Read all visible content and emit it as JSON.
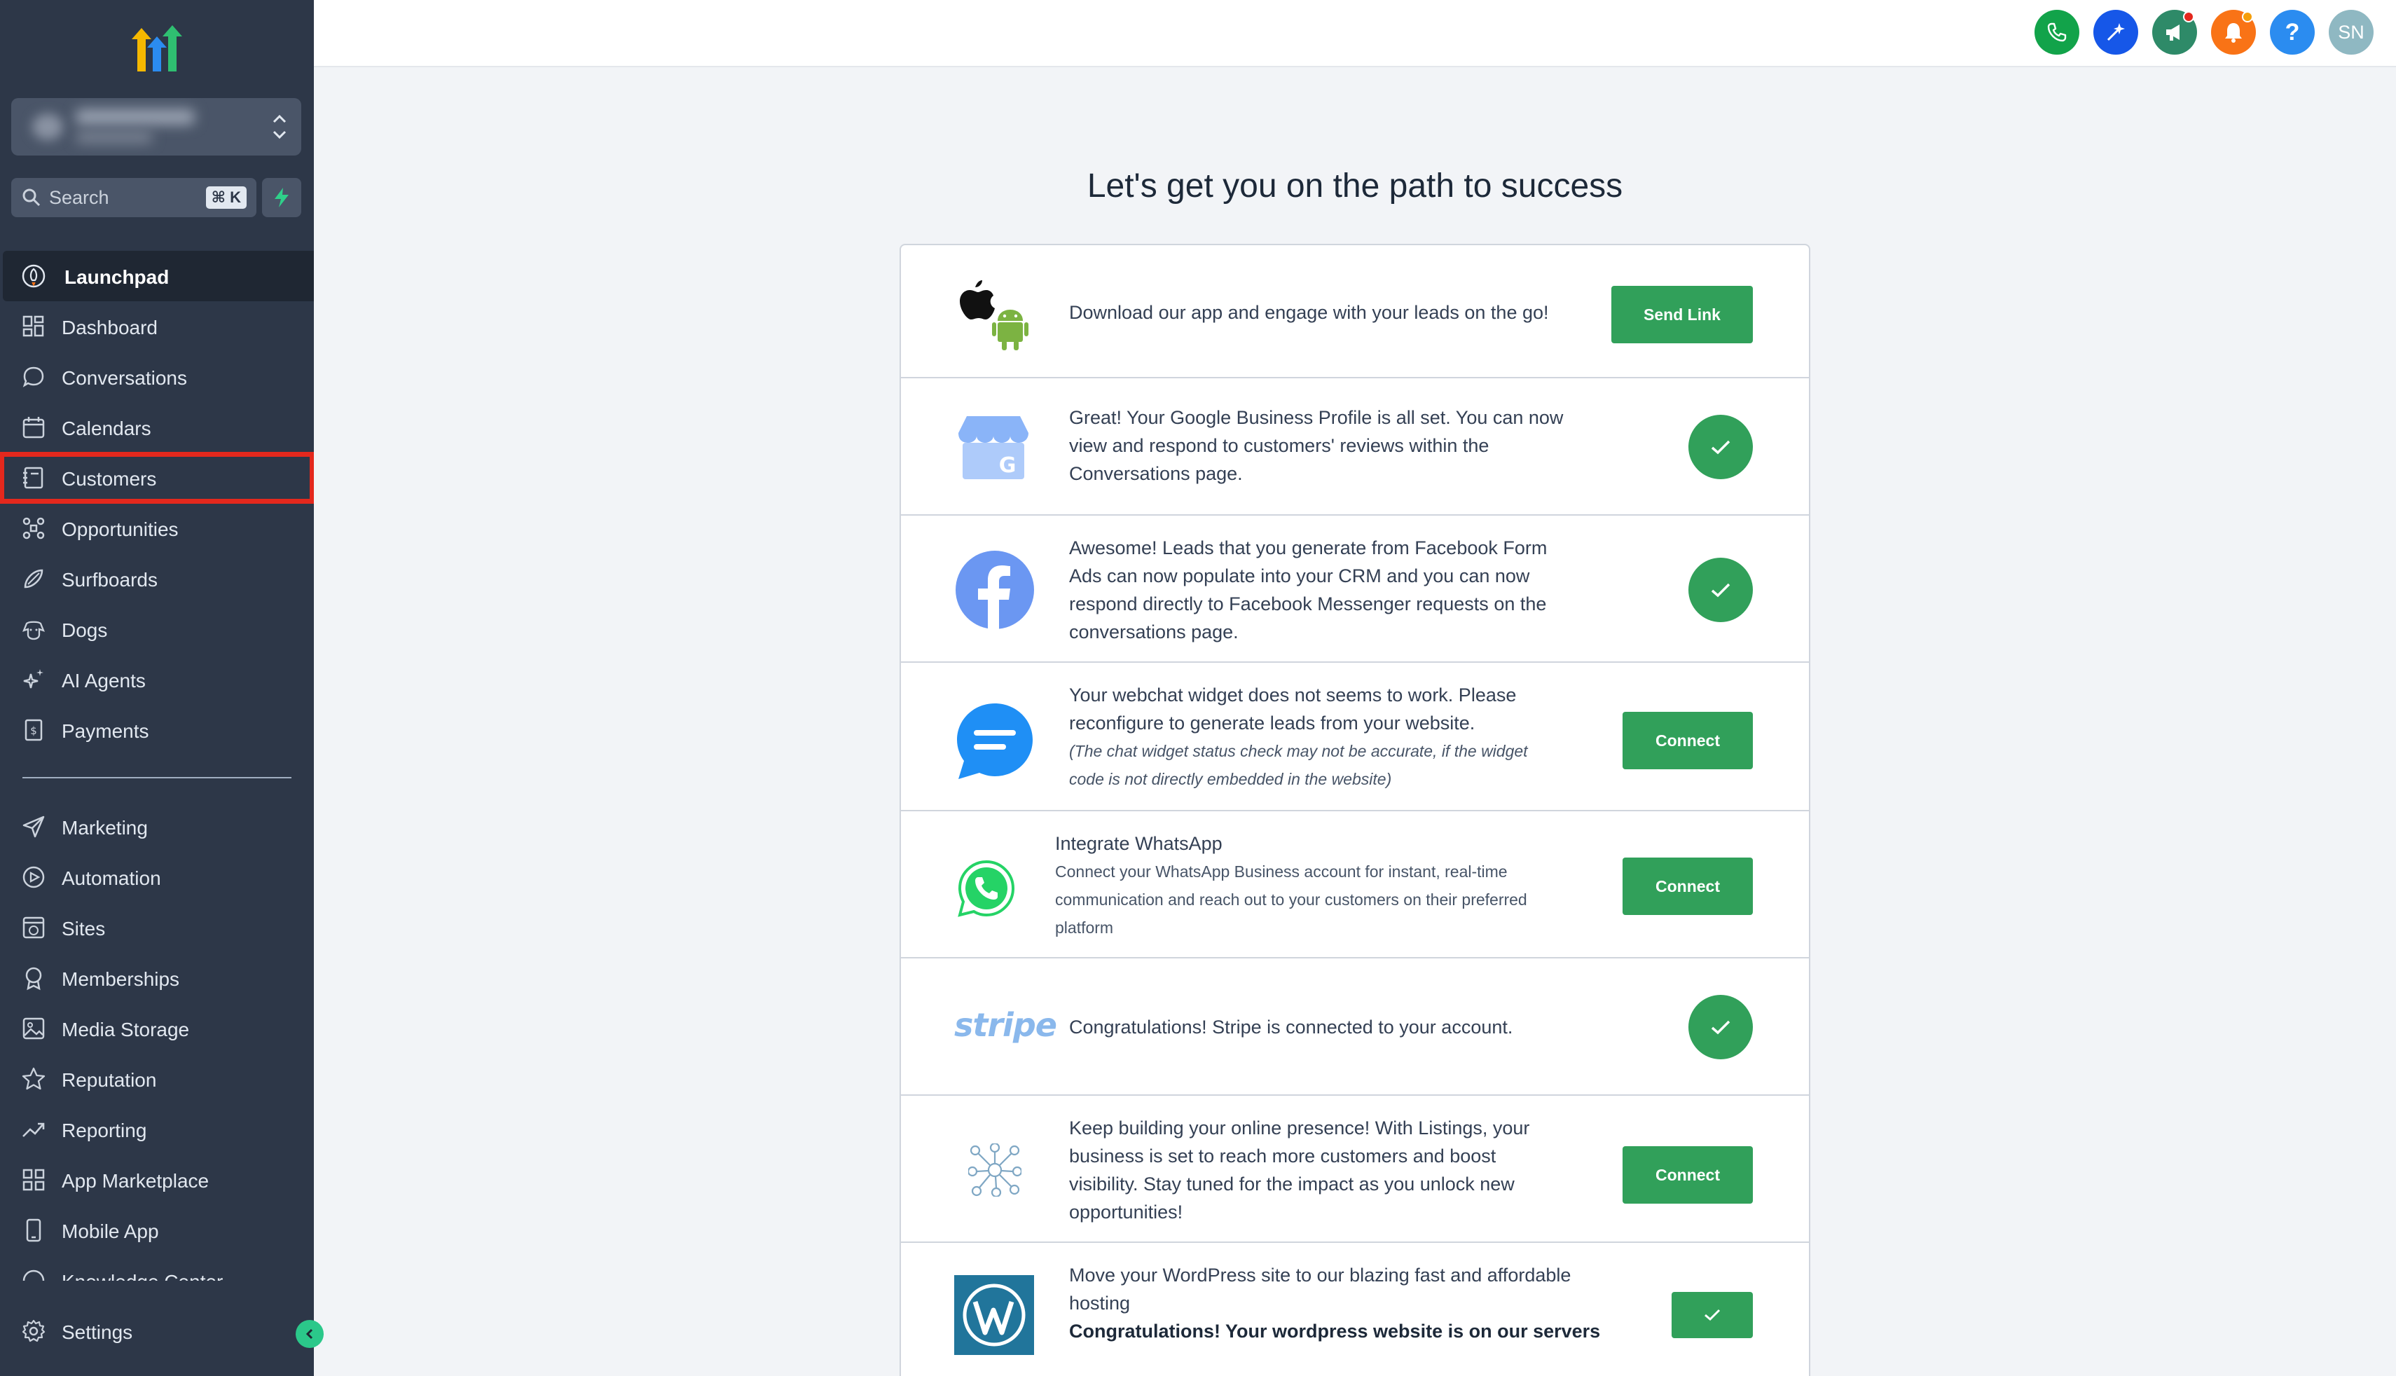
{
  "sidebar": {
    "search": {
      "placeholder": "Search",
      "shortcut": "⌘ K"
    },
    "nav_items": [
      {
        "label": "Launchpad",
        "icon": "rocket-icon"
      },
      {
        "label": "Dashboard",
        "icon": "dashboard-grid-icon"
      },
      {
        "label": "Conversations",
        "icon": "chat-bubble-icon"
      },
      {
        "label": "Calendars",
        "icon": "calendar-icon"
      },
      {
        "label": "Customers",
        "icon": "contacts-book-icon"
      },
      {
        "label": "Opportunities",
        "icon": "pipeline-icon"
      },
      {
        "label": "Surfboards",
        "icon": "surfboard-icon"
      },
      {
        "label": "Dogs",
        "icon": "dog-icon"
      },
      {
        "label": "AI Agents",
        "icon": "sparkle-icon"
      },
      {
        "label": "Payments",
        "icon": "invoice-icon"
      }
    ],
    "nav_items_2": [
      {
        "label": "Marketing",
        "icon": "send-icon"
      },
      {
        "label": "Automation",
        "icon": "automation-icon"
      },
      {
        "label": "Sites",
        "icon": "sites-icon"
      },
      {
        "label": "Memberships",
        "icon": "award-icon"
      },
      {
        "label": "Media Storage",
        "icon": "image-icon"
      },
      {
        "label": "Reputation",
        "icon": "star-icon"
      },
      {
        "label": "Reporting",
        "icon": "trend-icon"
      },
      {
        "label": "App Marketplace",
        "icon": "apps-grid-icon"
      },
      {
        "label": "Mobile App",
        "icon": "mobile-icon"
      },
      {
        "label": "Knowledge Center",
        "icon": "knowledge-icon"
      }
    ],
    "settings_label": "Settings"
  },
  "header": {
    "avatar_initials": "SN",
    "help_label": "?"
  },
  "main": {
    "title": "Let's get you on the path to success",
    "rows": [
      {
        "text": "Download our app and engage with your leads on the go!",
        "action": "Send Link"
      },
      {
        "text_lines": [
          "Great! Your Google Business Profile is all set. You can now",
          "view and respond to customers' reviews within the",
          "Conversations page."
        ]
      },
      {
        "text_lines": [
          "Awesome! Leads that you generate from Facebook Form",
          "Ads can now populate into your CRM and you can now",
          "respond directly to Facebook Messenger requests on the",
          "conversations page."
        ]
      },
      {
        "text_lines": [
          "Your webchat widget does not seems to work. Please",
          "reconfigure to generate leads from your website."
        ],
        "note_lines": [
          "(The chat widget status check may not be accurate, if the widget",
          "code is not directly embedded in the website)"
        ],
        "action": "Connect"
      },
      {
        "title": "Integrate WhatsApp",
        "sub_lines": [
          "Connect your WhatsApp Business account for instant, real-time",
          "communication and reach out to your customers on their preferred",
          "platform"
        ],
        "action": "Connect"
      },
      {
        "logo_text": "stripe",
        "text": "Congratulations! Stripe is connected to your account."
      },
      {
        "text_lines": [
          "Keep building your online presence! With Listings, your",
          "business is set to reach more customers and boost",
          "visibility. Stay tuned for the impact as you unlock new",
          "opportunities!"
        ],
        "action": "Connect"
      },
      {
        "text_lines": [
          "Move your WordPress site to our blazing fast and affordable",
          "hosting"
        ],
        "bold": "Congratulations! Your wordpress website is on our servers"
      }
    ]
  },
  "colors": {
    "sidebar_bg": "#2d3748",
    "active_bg": "#1f2733",
    "highlight_red": "#e4281d",
    "success_green": "#31a05a",
    "phone_green": "#12a34a",
    "ai_blue": "#1657e8",
    "announce_teal": "#2e8a68",
    "notify_orange": "#f97316",
    "help_blue": "#2b8cf0",
    "avatar_teal": "#8fb8c2"
  }
}
